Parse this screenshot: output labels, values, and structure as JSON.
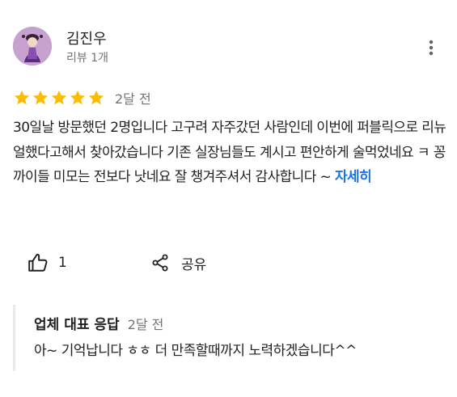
{
  "reviewer": {
    "name": "김진우",
    "review_count": "리뷰 1개"
  },
  "rating": {
    "stars": 5,
    "max_stars": 5,
    "date": "2달 전",
    "star_color": "#fbbc04"
  },
  "review": {
    "text": "30일날 방문했던 2명입니다 고구려 자주갔던 사람인데 이번에 퍼블릭으로 리뉴얼했다고해서 찾아갔습니다 기존 실장님들도 계시고 편안하게 술먹었네요 ㅋ 꽁까이들 미모는 전보다 낫네요 잘 챙겨주셔서 감사합니다 ~ ",
    "more_label": "자세히"
  },
  "actions": {
    "like_count": "1",
    "share_label": "공유"
  },
  "owner_response": {
    "title": "업체 대표 응답",
    "date": "2달 전",
    "text": "아~ 기억납니다 ㅎㅎ 더 만족할때까지 노력하겠습니다^^"
  },
  "colors": {
    "link": "#1a73e8",
    "secondary_text": "#70757a",
    "divider": "#e8eaed"
  }
}
